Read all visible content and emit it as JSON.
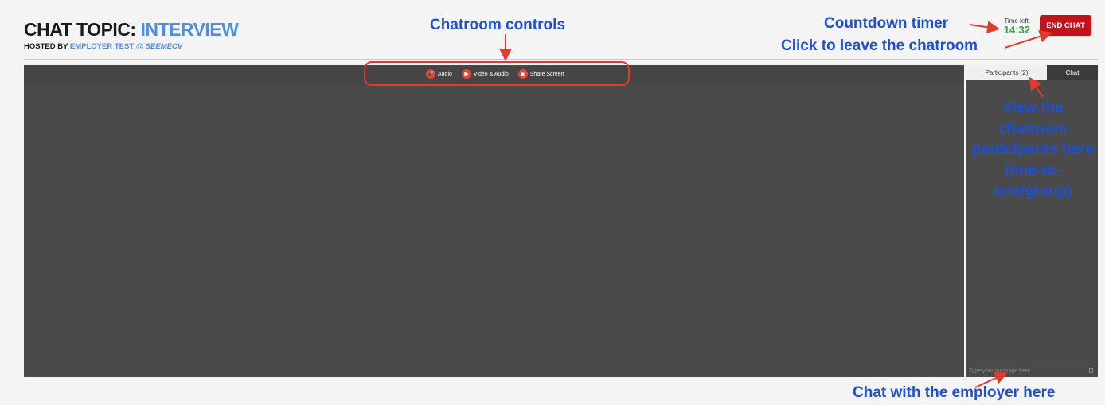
{
  "header": {
    "title_prefix": "CHAT TOPIC:",
    "title_topic": "INTERVIEW",
    "hosted_prefix": "HOSTED BY",
    "host_name": "EMPLOYER TEST",
    "host_company": "@ SEEMECV"
  },
  "timer": {
    "label": "Time left:",
    "value": "14:32"
  },
  "end_chat_label": "END CHAT",
  "controls": [
    {
      "label": "Audio",
      "icon": "microphone-icon"
    },
    {
      "label": "Video & Audio",
      "icon": "video-camera-icon"
    },
    {
      "label": "Share Screen",
      "icon": "share-screen-icon"
    }
  ],
  "sidebar": {
    "tab_participants": "Participants (2)",
    "tab_chat": "Chat",
    "message_placeholder": "Type your message here..."
  },
  "annotations": {
    "controls": "Chatroom controls",
    "timer": "Countdown timer",
    "leave": "Click to leave the chatroom",
    "participants": "View the chatroom participants here (one-to-one/group)",
    "chat": "Chat with the employer here"
  },
  "colors": {
    "accent_blue": "#4d8fdc",
    "end_chat_red": "#c4121b",
    "timer_green": "#3aa04a",
    "annotation_blue": "#1f4fd6",
    "annotation_red": "#e23b2b"
  }
}
